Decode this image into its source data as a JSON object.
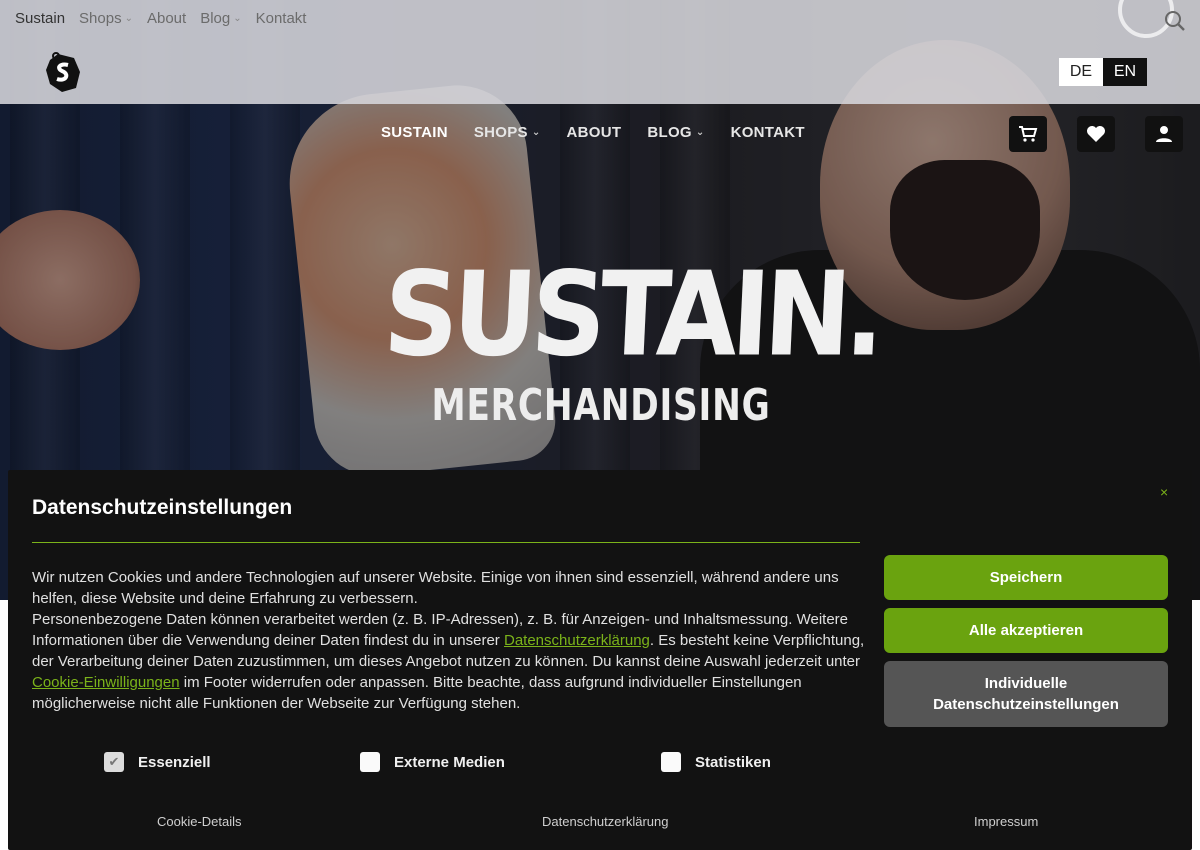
{
  "topnav": {
    "items": [
      {
        "label": "Sustain"
      },
      {
        "label": "Shops"
      },
      {
        "label": "About"
      },
      {
        "label": "Blog"
      },
      {
        "label": "Kontakt"
      }
    ]
  },
  "language": {
    "de": "DE",
    "en": "EN",
    "active": "EN"
  },
  "mainnav": {
    "items": [
      {
        "label": "SUSTAIN"
      },
      {
        "label": "SHOPS"
      },
      {
        "label": "ABOUT"
      },
      {
        "label": "BLOG"
      },
      {
        "label": "KONTAKT"
      }
    ]
  },
  "icons": {
    "search": "search-icon",
    "cart": "cart-icon",
    "wishlist": "heart-icon",
    "account": "user-icon",
    "logo": "sustain-logo",
    "close": "close-icon",
    "check": "checkmark-icon"
  },
  "hero": {
    "brand_title": "SUSTAIN.",
    "brand_subtitle": "MERCHANDISING"
  },
  "cookie": {
    "title": "Datenschutzeinstellungen",
    "p1": "Wir nutzen Cookies und andere Technologien auf unserer Website. Einige von ihnen sind essenziell, während andere uns helfen, diese Website und deine Erfahrung zu verbessern.",
    "p2a": "Personenbezogene Daten können verarbeitet werden (z. B. IP-Adressen), z. B. für Anzeigen- und Inhaltsmessung. Weitere Informationen über die Verwendung deiner Daten findest du in unserer ",
    "p2link": "Datenschutzerklärung",
    "p2b": ". Es besteht keine Verpflichtung, der Verarbeitung deiner Daten zuzustimmen, um dieses Angebot nutzen zu können. Du kannst deine Auswahl jederzeit unter ",
    "p2link2": "Cookie-Einwilligungen",
    "p2c": " im Footer widerrufen oder anpassen. Bitte beachte, dass aufgrund individueller Einstellungen möglicherweise nicht alle Funktionen der Webseite zur Verfügung stehen.",
    "close": "×",
    "buttons": {
      "save": "Speichern",
      "accept_all": "Alle akzeptieren",
      "individual_line1": "Individuelle",
      "individual_line2": "Datenschutzeinstellungen"
    },
    "checkboxes": [
      {
        "label": "Essenziell",
        "checked": true
      },
      {
        "label": "Externe Medien",
        "checked": false
      },
      {
        "label": "Statistiken",
        "checked": false
      }
    ],
    "links": {
      "details": "Cookie-Details",
      "privacy": "Datenschutzerklärung",
      "imprint": "Impressum"
    }
  },
  "colors": {
    "accent": "#6aa30f",
    "banner_bg": "#121212",
    "grey_button": "#555555"
  }
}
